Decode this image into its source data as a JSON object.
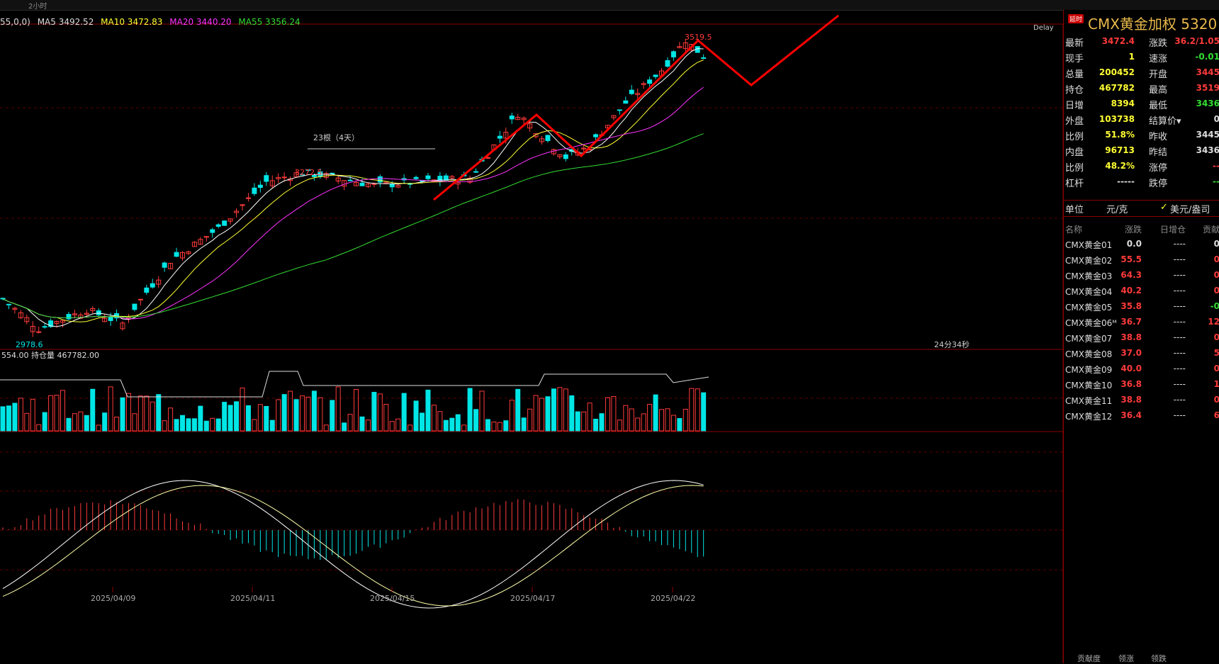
{
  "toolbar": {
    "period": "2小时"
  },
  "chart_header": {
    "params_text": "55,0,0)",
    "ma5": "MA5 3492.52",
    "ma10": "MA10 3472.83",
    "ma20": "MA20 3440.20",
    "ma55": "MA55 3356.24",
    "code_fragment": "5320)",
    "delay": "Delay"
  },
  "annotations": {
    "high_label": "3519.5",
    "mid_high_label": "3272.5",
    "low_label": "2978.6",
    "range_label": "23根（4天）",
    "countdown": "24分34秒"
  },
  "volume_header": {
    "left": "554.00",
    "open_interest": "持仓量 467782.00"
  },
  "x_axis_dates": [
    "2025/04/09",
    "2025/04/11",
    "2025/04/15",
    "2025/04/17",
    "2025/04/22"
  ],
  "colors": {
    "up": "#ff3a3a",
    "down": "#00e5e5",
    "ma5": "#ffffff",
    "ma10": "#ffff33",
    "ma20": "#ff33ff",
    "ma55": "#33dd33",
    "accent_red": "#ff0000"
  },
  "panel": {
    "badge": "延时",
    "title": "CMX黄金加权  5320",
    "quotes": [
      {
        "l1": "最新",
        "v1": "3472.4",
        "c1": "red",
        "l2": "涨跌",
        "v2": "36.2/1.05",
        "c2": "red"
      },
      {
        "l1": "现手",
        "v1": "1",
        "c1": "yel",
        "l2": "速涨",
        "v2": "-0.01",
        "c2": "grn"
      },
      {
        "l1": "总量",
        "v1": "200452",
        "c1": "yel",
        "l2": "开盘",
        "v2": "3445",
        "c2": "red"
      },
      {
        "l1": "持仓",
        "v1": "467782",
        "c1": "yel",
        "l2": "最高",
        "v2": "3519",
        "c2": "red"
      },
      {
        "l1": "日增",
        "v1": "8394",
        "c1": "yel",
        "l2": "最低",
        "v2": "3436",
        "c2": "grn"
      },
      {
        "l1": "外盘",
        "v1": "103738",
        "c1": "yel",
        "l2": "结算价▾",
        "v2": "0",
        "c2": "wht"
      },
      {
        "l1": "比例",
        "v1": "51.8%",
        "c1": "yel",
        "l2": "昨收",
        "v2": "3445",
        "c2": "wht"
      },
      {
        "l1": "内盘",
        "v1": "96713",
        "c1": "yel",
        "l2": "昨结",
        "v2": "3436",
        "c2": "wht"
      },
      {
        "l1": "比例",
        "v1": "48.2%",
        "c1": "yel",
        "l2": "涨停",
        "v2": "--",
        "c2": "red"
      },
      {
        "l1": "杠杆",
        "v1": "-----",
        "c1": "wht",
        "l2": "跌停",
        "v2": "--",
        "c2": "grn"
      }
    ],
    "unit_label": "单位",
    "unit_value": "元/克",
    "unit_check": "✓",
    "unit_alt": "美元/盎司",
    "contract_header": {
      "n": "名称",
      "z": "涨跌",
      "r": "日增仓",
      "g": "贡献"
    },
    "contracts": [
      {
        "n": "CMX黄金01",
        "z": "0.0",
        "zc": "wht",
        "r": "----",
        "g": "0",
        "gc": "wht"
      },
      {
        "n": "CMX黄金02",
        "z": "55.5",
        "zc": "red",
        "r": "----",
        "g": "0",
        "gc": "red"
      },
      {
        "n": "CMX黄金03",
        "z": "64.3",
        "zc": "red",
        "r": "----",
        "g": "0",
        "gc": "red"
      },
      {
        "n": "CMX黄金04",
        "z": "40.2",
        "zc": "red",
        "r": "----",
        "g": "0",
        "gc": "red"
      },
      {
        "n": "CMX黄金05",
        "z": "35.8",
        "zc": "red",
        "r": "----",
        "g": "-0",
        "gc": "grn"
      },
      {
        "n": "CMX黄金06ᴹ",
        "z": "36.7",
        "zc": "red",
        "r": "----",
        "g": "12",
        "gc": "red"
      },
      {
        "n": "CMX黄金07",
        "z": "38.8",
        "zc": "red",
        "r": "----",
        "g": "0",
        "gc": "red"
      },
      {
        "n": "CMX黄金08",
        "z": "37.0",
        "zc": "red",
        "r": "----",
        "g": "5",
        "gc": "red"
      },
      {
        "n": "CMX黄金09",
        "z": "40.0",
        "zc": "red",
        "r": "----",
        "g": "0",
        "gc": "red"
      },
      {
        "n": "CMX黄金10",
        "z": "36.8",
        "zc": "red",
        "r": "----",
        "g": "1",
        "gc": "red"
      },
      {
        "n": "CMX黄金11",
        "z": "38.8",
        "zc": "red",
        "r": "----",
        "g": "0",
        "gc": "red"
      },
      {
        "n": "CMX黄金12",
        "z": "36.4",
        "zc": "red",
        "r": "----",
        "g": "6",
        "gc": "red"
      }
    ],
    "bottom_tabs": [
      "贡献度",
      "领涨",
      "领跌"
    ]
  },
  "chart_data": {
    "type": "candlestick",
    "price_high": 3519.5,
    "price_low": 2978.6,
    "ma_latest": {
      "MA5": 3492.52,
      "MA10": 3472.83,
      "MA20": 3440.2,
      "MA55": 3356.24
    },
    "open_interest": 467782.0
  }
}
